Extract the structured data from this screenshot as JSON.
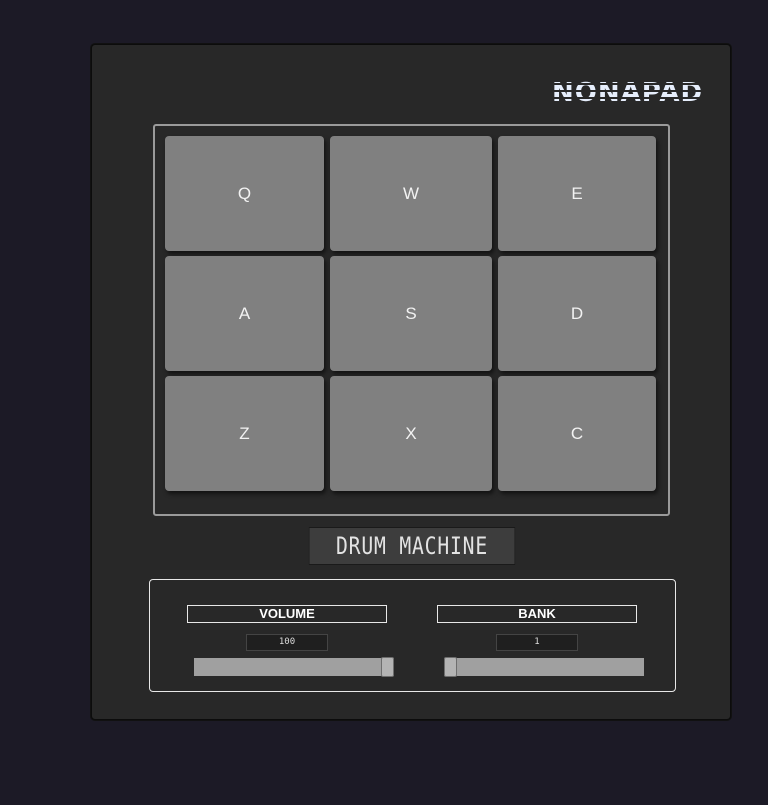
{
  "brand": {
    "logo_text": "NONAPAD"
  },
  "pads": [
    {
      "key": "Q"
    },
    {
      "key": "W"
    },
    {
      "key": "E"
    },
    {
      "key": "A"
    },
    {
      "key": "S"
    },
    {
      "key": "D"
    },
    {
      "key": "Z"
    },
    {
      "key": "X"
    },
    {
      "key": "C"
    }
  ],
  "display": {
    "text": "DRUM MACHINE"
  },
  "volume": {
    "label": "VOLUME",
    "value": "100",
    "level": 1.0
  },
  "bank": {
    "label": "BANK",
    "value": "1",
    "level": 0.0
  },
  "colors": {
    "background": "#1c1a26",
    "panel": "#282828",
    "pad": "#808080",
    "slider_track": "#a0a0a0"
  }
}
